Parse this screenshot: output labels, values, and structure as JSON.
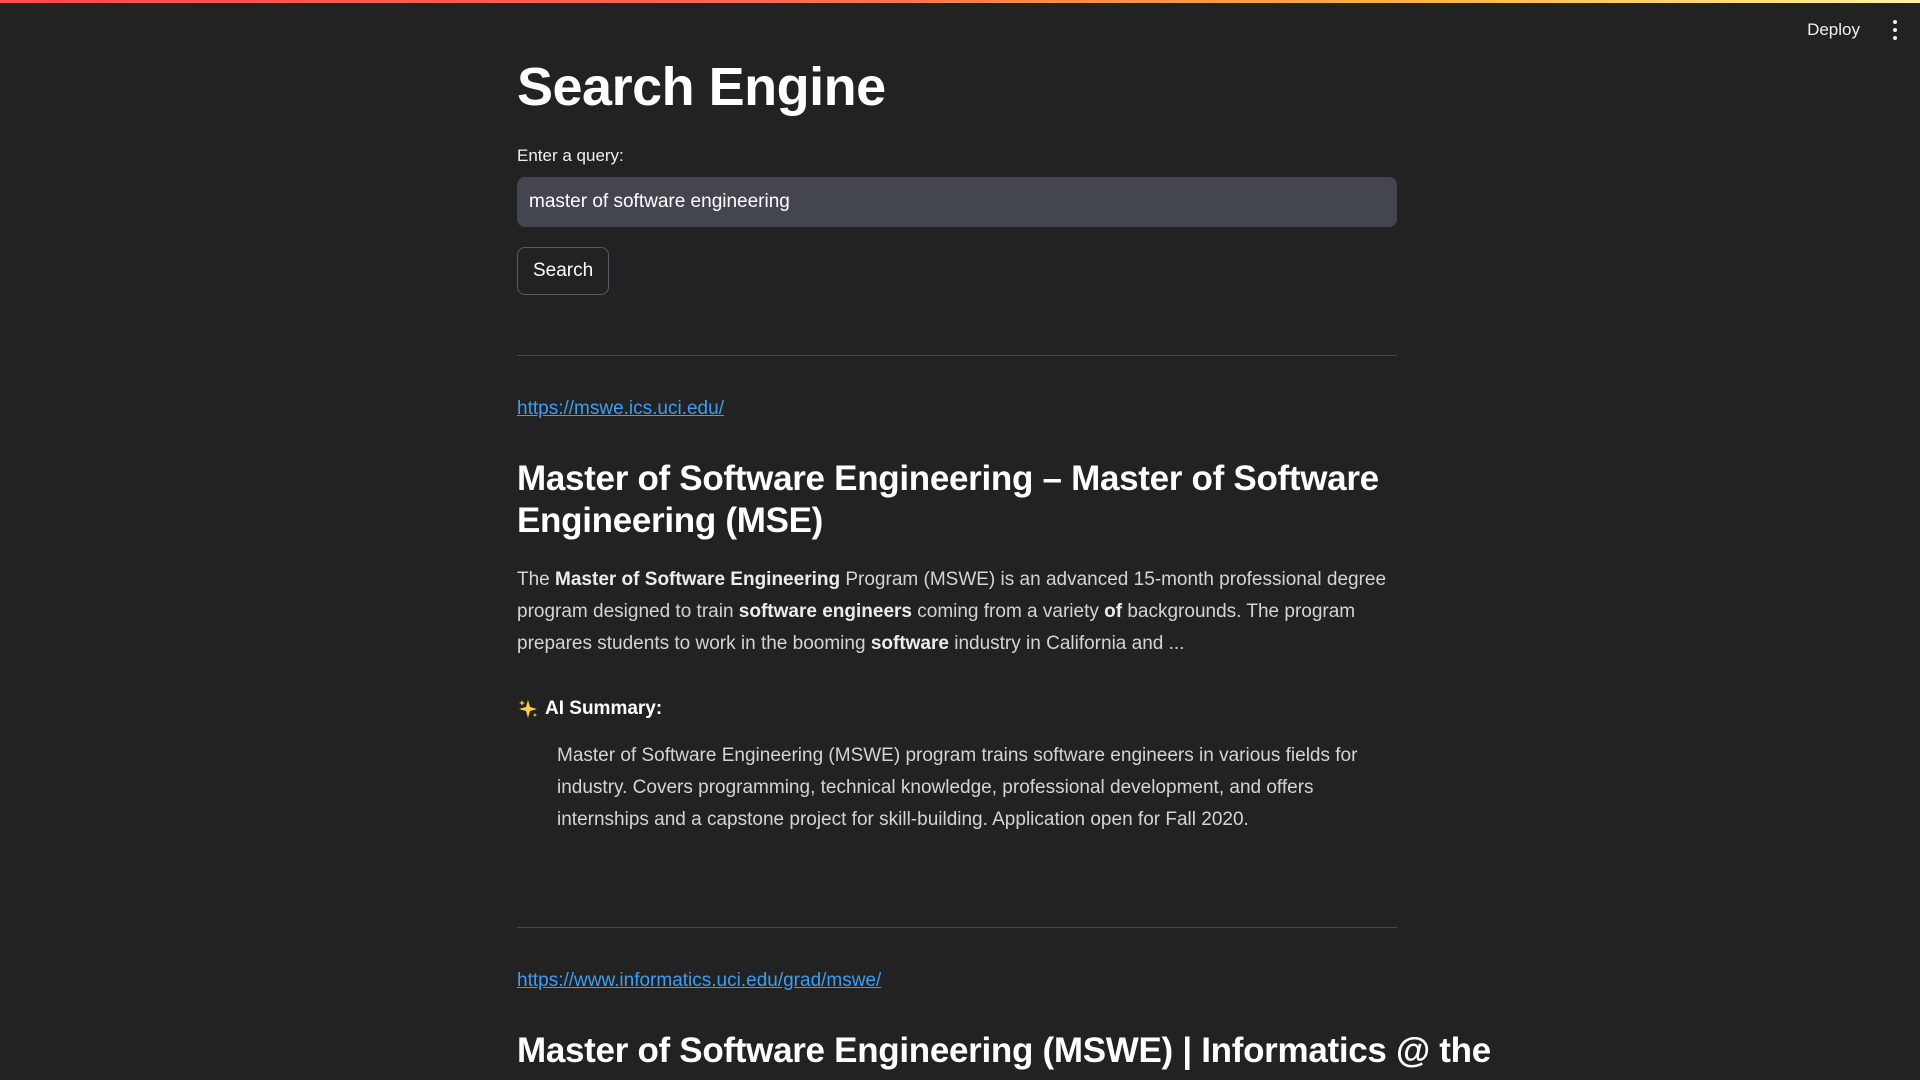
{
  "header": {
    "deploy_label": "Deploy",
    "menu_icon": "vertical-ellipsis-icon"
  },
  "page": {
    "title": "Search Engine",
    "query_label": "Enter a query:",
    "query_value": "master of software engineering",
    "search_label": "Search"
  },
  "results": [
    {
      "url": "https://mswe.ics.uci.edu/",
      "title": "Master of Software Engineering – Master of Software Engineering (MSE)",
      "snippet": [
        {
          "text": "The ",
          "bold": false
        },
        {
          "text": "Master of Software Engineering",
          "bold": true
        },
        {
          "text": " Program (MSWE) is an advanced 15-month professional degree program designed to train ",
          "bold": false
        },
        {
          "text": "software engineers",
          "bold": true
        },
        {
          "text": " coming from a variety ",
          "bold": false
        },
        {
          "text": "of",
          "bold": true
        },
        {
          "text": " backgrounds. The program prepares students to work in the booming ",
          "bold": false
        },
        {
          "text": "software",
          "bold": true
        },
        {
          "text": " industry in California and ...",
          "bold": false
        }
      ],
      "ai_label": "AI Summary:",
      "ai_icon": "sparkles-icon",
      "ai_summary": "Master of Software Engineering (MSWE) program trains software engineers in various fields for industry. Covers programming, technical knowledge, professional development, and offers internships and a capstone project for skill-building. Application open for Fall 2020."
    },
    {
      "url": "https://www.informatics.uci.edu/grad/mswe/",
      "title": "Master of Software Engineering (MSWE) | Informatics @ the"
    }
  ],
  "colors": {
    "background": "#222222",
    "link": "#3d9df3",
    "input_bg": "#43464f",
    "accent_gradient_start": "#ff4b4b",
    "accent_gradient_end": "#fff3a0"
  }
}
